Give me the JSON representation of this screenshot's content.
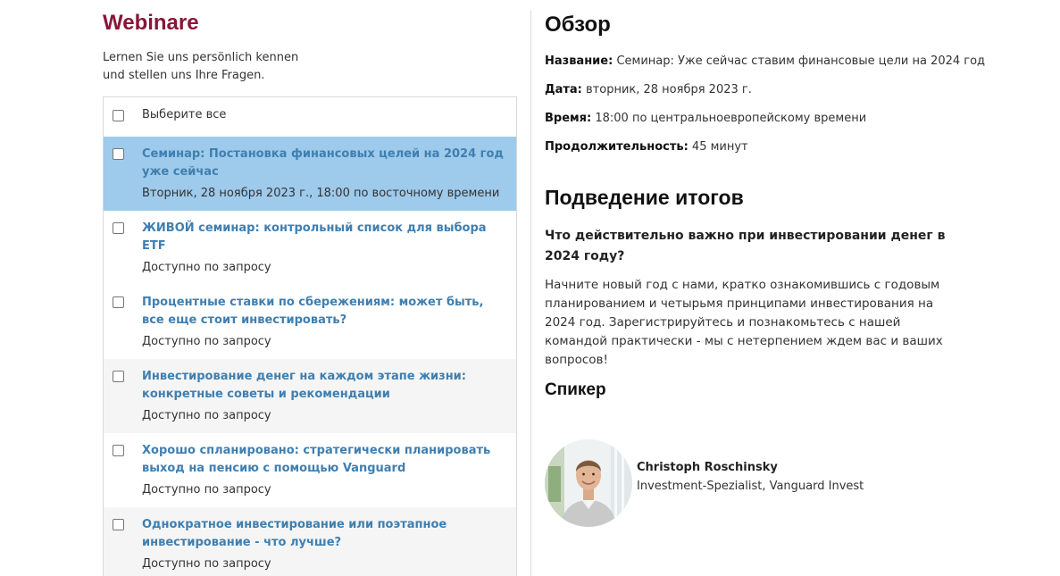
{
  "left": {
    "title": "Webinare",
    "subtitle_line1": "Lernen Sie uns persönlich kennen",
    "subtitle_line2": "und stellen uns Ihre Fragen.",
    "select_all": "Выберите все",
    "webinars": [
      {
        "name": "Семинар: Постановка финансовых целей на 2024 год уже сейчас",
        "when": "Вторник, 28 ноября 2023 г., 18:00 по восточному времени"
      },
      {
        "name": "ЖИВОЙ семинар: контрольный список для выбора ETF",
        "when": "Доступно по запросу"
      },
      {
        "name": "Процентные ставки по сбережениям: может быть, все еще стоит инвестировать?",
        "when": "Доступно по запросу"
      },
      {
        "name": "Инвестирование денег на каждом этапе жизни: конкретные советы и рекомендации",
        "when": "Доступно по запросу"
      },
      {
        "name": "Хорошо спланировано: стратегически планировать выход на пенсию с помощью Vanguard",
        "when": "Доступно по запросу"
      },
      {
        "name": "Однократное инвестирование или поэтапное инвестирование - что лучше?",
        "when": "Доступно по запросу"
      }
    ]
  },
  "right": {
    "overview_heading": "Обзор",
    "name_label": "Название:",
    "name_value": "Семинар: Уже сейчас ставим финансовые цели на 2024 год",
    "date_label": "Дата:",
    "date_value": "вторник, 28 ноября 2023 г.",
    "time_label": "Время:",
    "time_value": "18:00 по центральноевропейскому времени",
    "duration_label": "Продолжительность:",
    "duration_value": "45 минут",
    "summary_heading": "Подведение итогов",
    "question": "Что действительно важно при инвестировании денег в 2024 году?",
    "description": "Начните новый год с нами, кратко ознакомившись с годовым планированием и четырьмя принципами инвестирования на 2024 год. Зарегистрируйтесь и познакомьтесь с нашей командой практически - мы с нетерпением ждем вас и ваших вопросов!",
    "speaker_heading": "Спикер",
    "speaker_name": "Christoph Roschinsky",
    "speaker_role": "Investment-Spezialist, Vanguard Invest"
  },
  "colors": {
    "title": "#8a1538",
    "link": "#3f7fb0",
    "active_row": "#9ecaeb",
    "alt_row": "#f5f5f5"
  }
}
